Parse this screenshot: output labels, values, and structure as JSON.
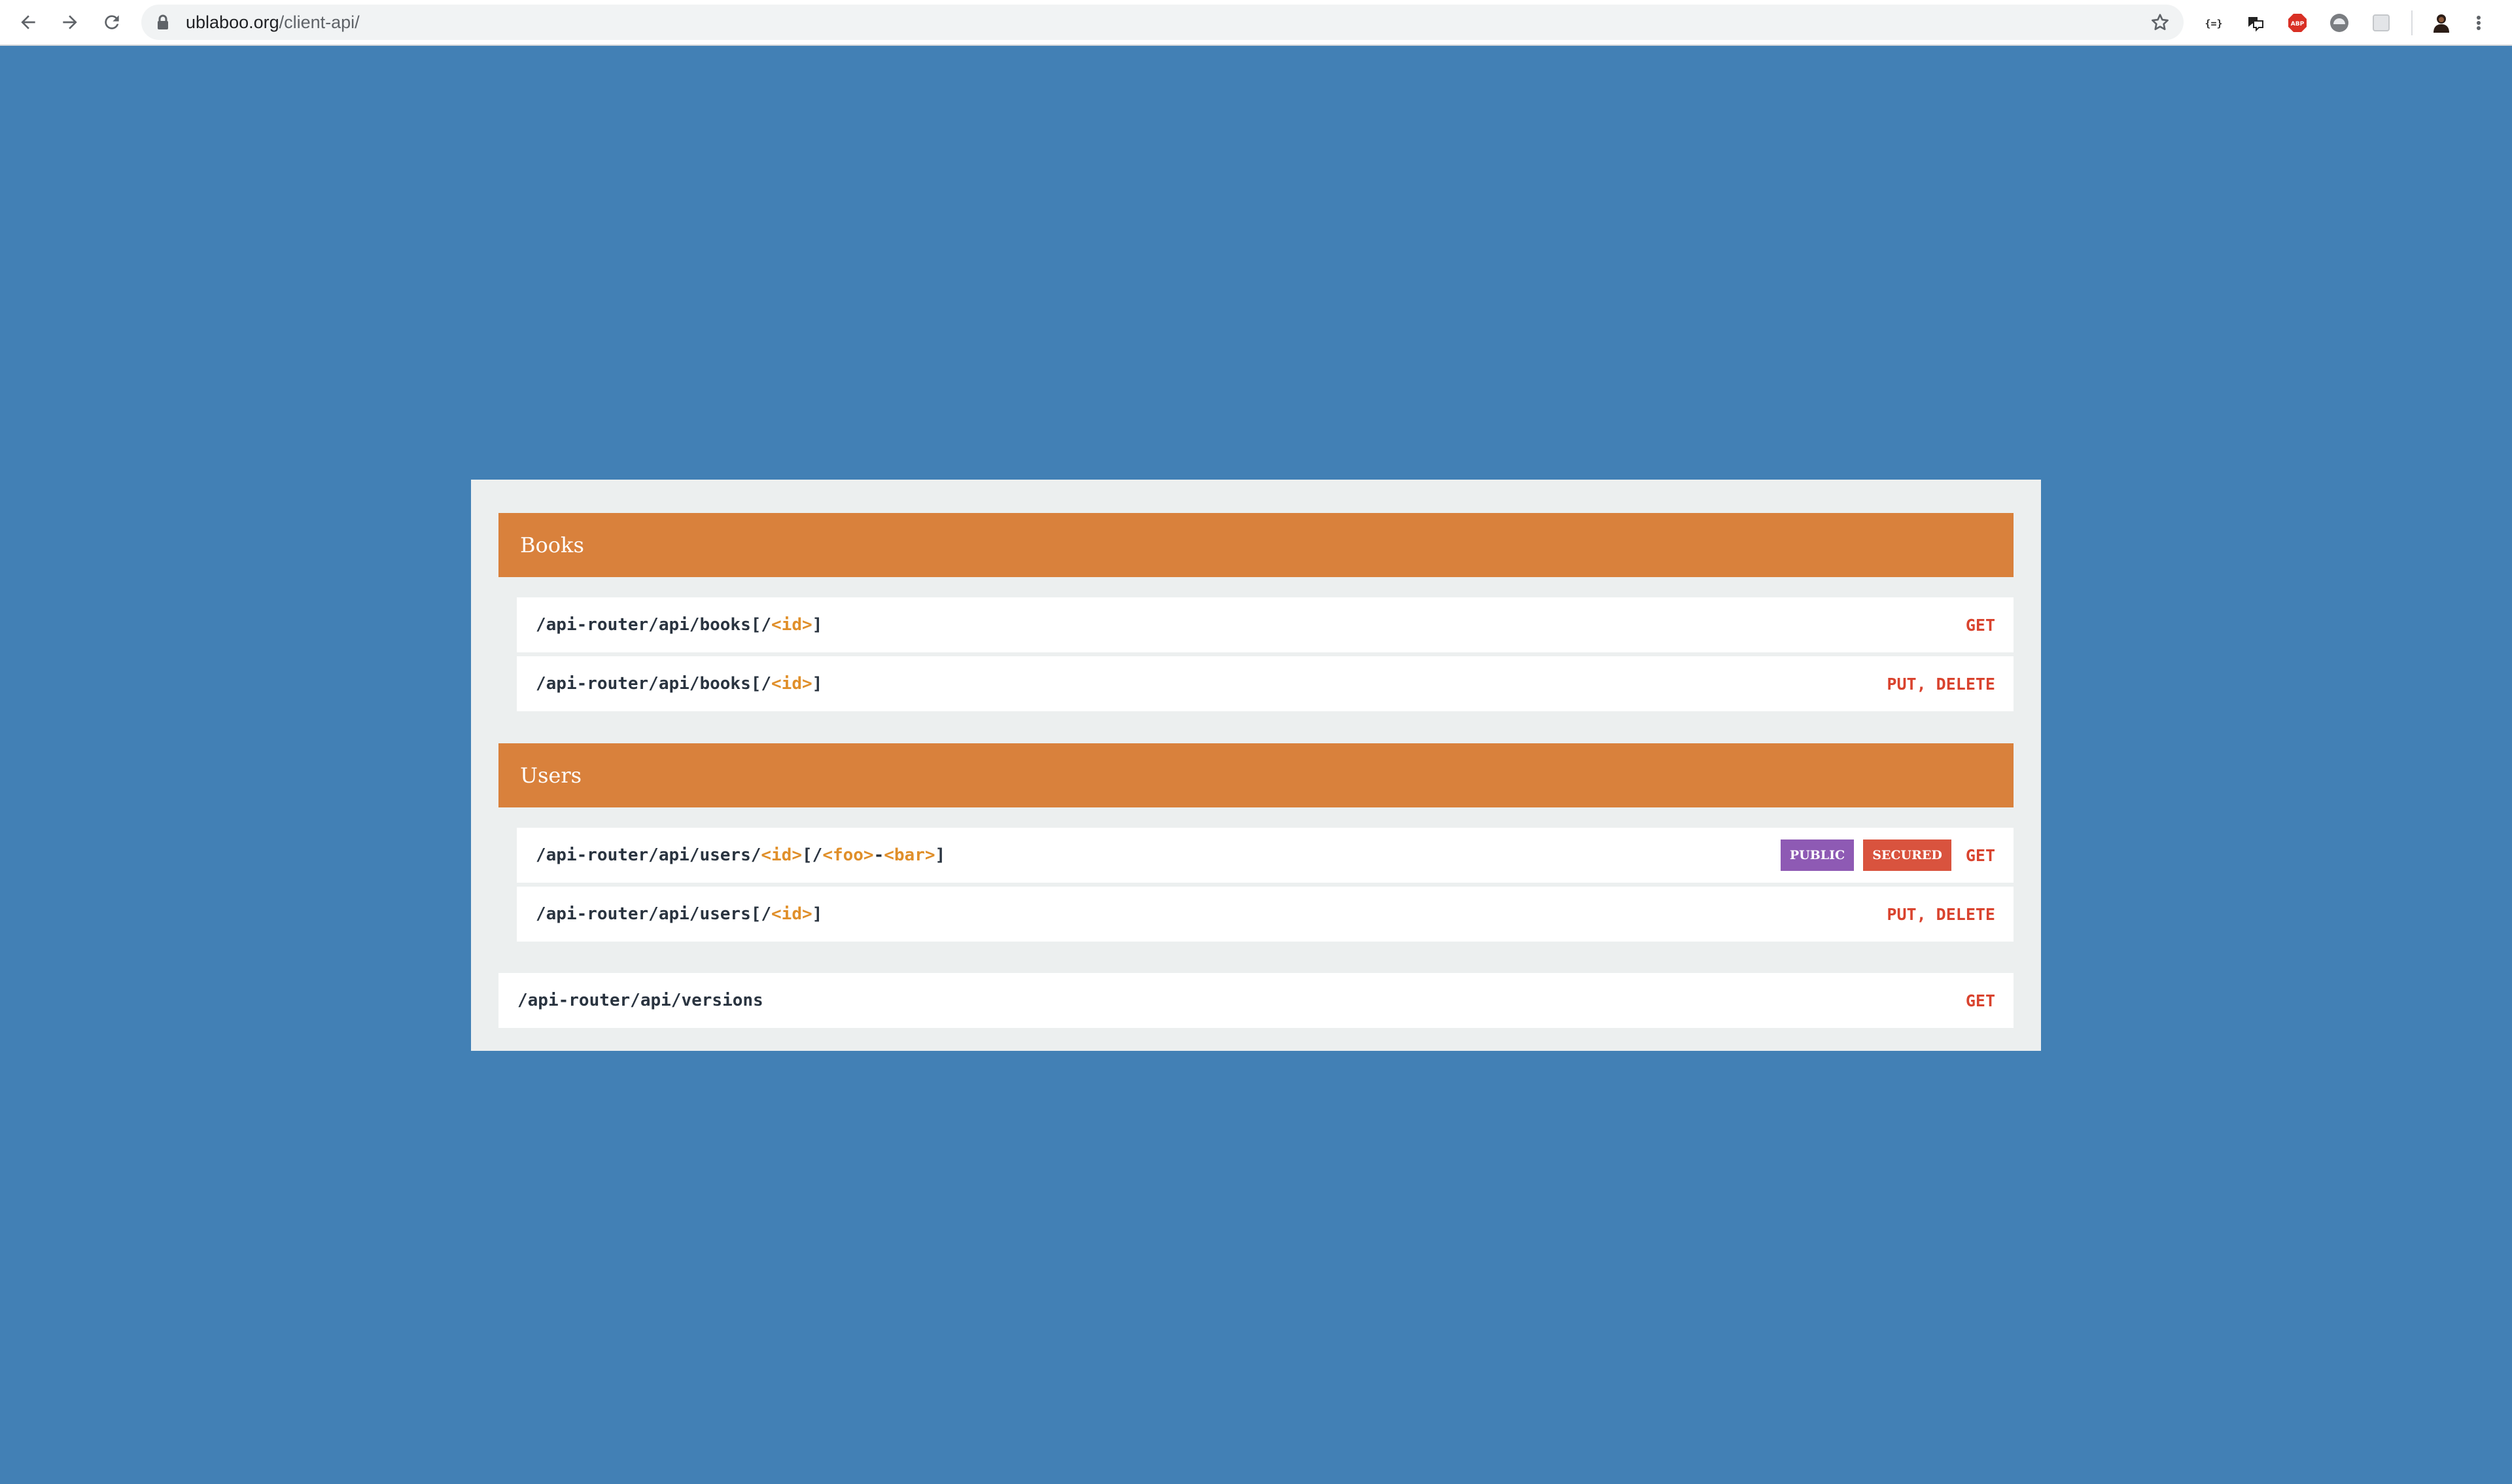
{
  "browser": {
    "url_domain": "ublaboo.org",
    "url_path": "/client-api/",
    "extensions": [
      "json-formatter-icon",
      "translate-icon",
      "adblock-icon",
      "incognito-like-icon",
      "page-icon"
    ]
  },
  "colors": {
    "page_background": "#4280b5",
    "panel_background": "#ecefef",
    "section_header": "#d9813c",
    "param": "#e08f2a",
    "method": "#d9432e",
    "badge_public": "#8e5ab4",
    "badge_secured": "#d9533e"
  },
  "sections": [
    {
      "title": "Books",
      "endpoints": [
        {
          "path_parts": [
            "/api-router/api/books[/",
            "<id>",
            "]"
          ],
          "methods": "GET",
          "badges": []
        },
        {
          "path_parts": [
            "/api-router/api/books[/",
            "<id>",
            "]"
          ],
          "methods": "PUT, DELETE",
          "badges": []
        }
      ]
    },
    {
      "title": "Users",
      "endpoints": [
        {
          "path_parts": [
            "/api-router/api/users/",
            "<id>",
            "[/",
            "<foo>",
            "-",
            "<bar>",
            "]"
          ],
          "methods": "GET",
          "badges": [
            "PUBLIC",
            "SECURED"
          ]
        },
        {
          "path_parts": [
            "/api-router/api/users[/",
            "<id>",
            "]"
          ],
          "methods": "PUT, DELETE",
          "badges": []
        }
      ]
    }
  ],
  "standalone": {
    "path": "/api-router/api/versions",
    "methods": "GET"
  }
}
